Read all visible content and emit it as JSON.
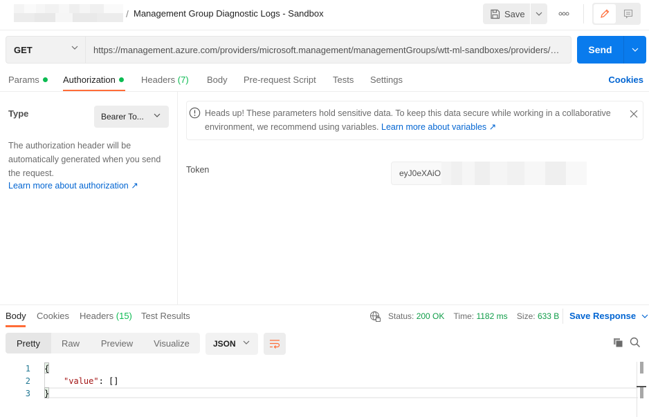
{
  "header": {
    "breadcrumb_separator": "/",
    "request_title": "Management Group Diagnostic Logs - Sandbox",
    "save_label": "Save",
    "more_label": "ooo"
  },
  "url_bar": {
    "method": "GET",
    "url": "https://management.azure.com/providers/microsoft.management/managementGroups/wtt-ml-sandboxes/providers/microsoft.insights/diagnosticSettings",
    "send_label": "Send"
  },
  "request_tabs": [
    {
      "label": "Params",
      "dot": true
    },
    {
      "label": "Authorization",
      "dot": true,
      "active": true
    },
    {
      "label": "Headers",
      "count": "(7)"
    },
    {
      "label": "Body"
    },
    {
      "label": "Pre-request Script"
    },
    {
      "label": "Tests"
    },
    {
      "label": "Settings"
    }
  ],
  "cookies_label": "Cookies",
  "auth": {
    "type_label": "Type",
    "type_value": "Bearer To...",
    "description": "The authorization header will be automatically generated when you send the request.",
    "learn_more": "Learn more about authorization ↗",
    "notice_text": "Heads up! These parameters hold sensitive data. To keep this data secure while working in a collaborative environment, we recommend using variables.",
    "notice_link": "Learn more about variables ↗",
    "token_label": "Token",
    "token_value": "eyJ0eXAiO"
  },
  "response": {
    "tabs": [
      {
        "label": "Body",
        "active": true
      },
      {
        "label": "Cookies"
      },
      {
        "label": "Headers",
        "count": "(15)"
      },
      {
        "label": "Test Results"
      }
    ],
    "status_label": "Status:",
    "status_value": "200 OK",
    "time_label": "Time:",
    "time_value": "1182 ms",
    "size_label": "Size:",
    "size_value": "633 B",
    "save_response_label": "Save Response",
    "view_modes": [
      "Pretty",
      "Raw",
      "Preview",
      "Visualize"
    ],
    "active_view": "Pretty",
    "format": "JSON",
    "code_lines": [
      {
        "num": "1",
        "text": "{"
      },
      {
        "num": "2",
        "key": "\"value\"",
        "rest": ": []"
      },
      {
        "num": "3",
        "text": "}"
      }
    ]
  },
  "colors": {
    "accent": "#ff6c37",
    "primary": "#097bed",
    "link": "#0265d2",
    "success": "#0cbb52"
  }
}
